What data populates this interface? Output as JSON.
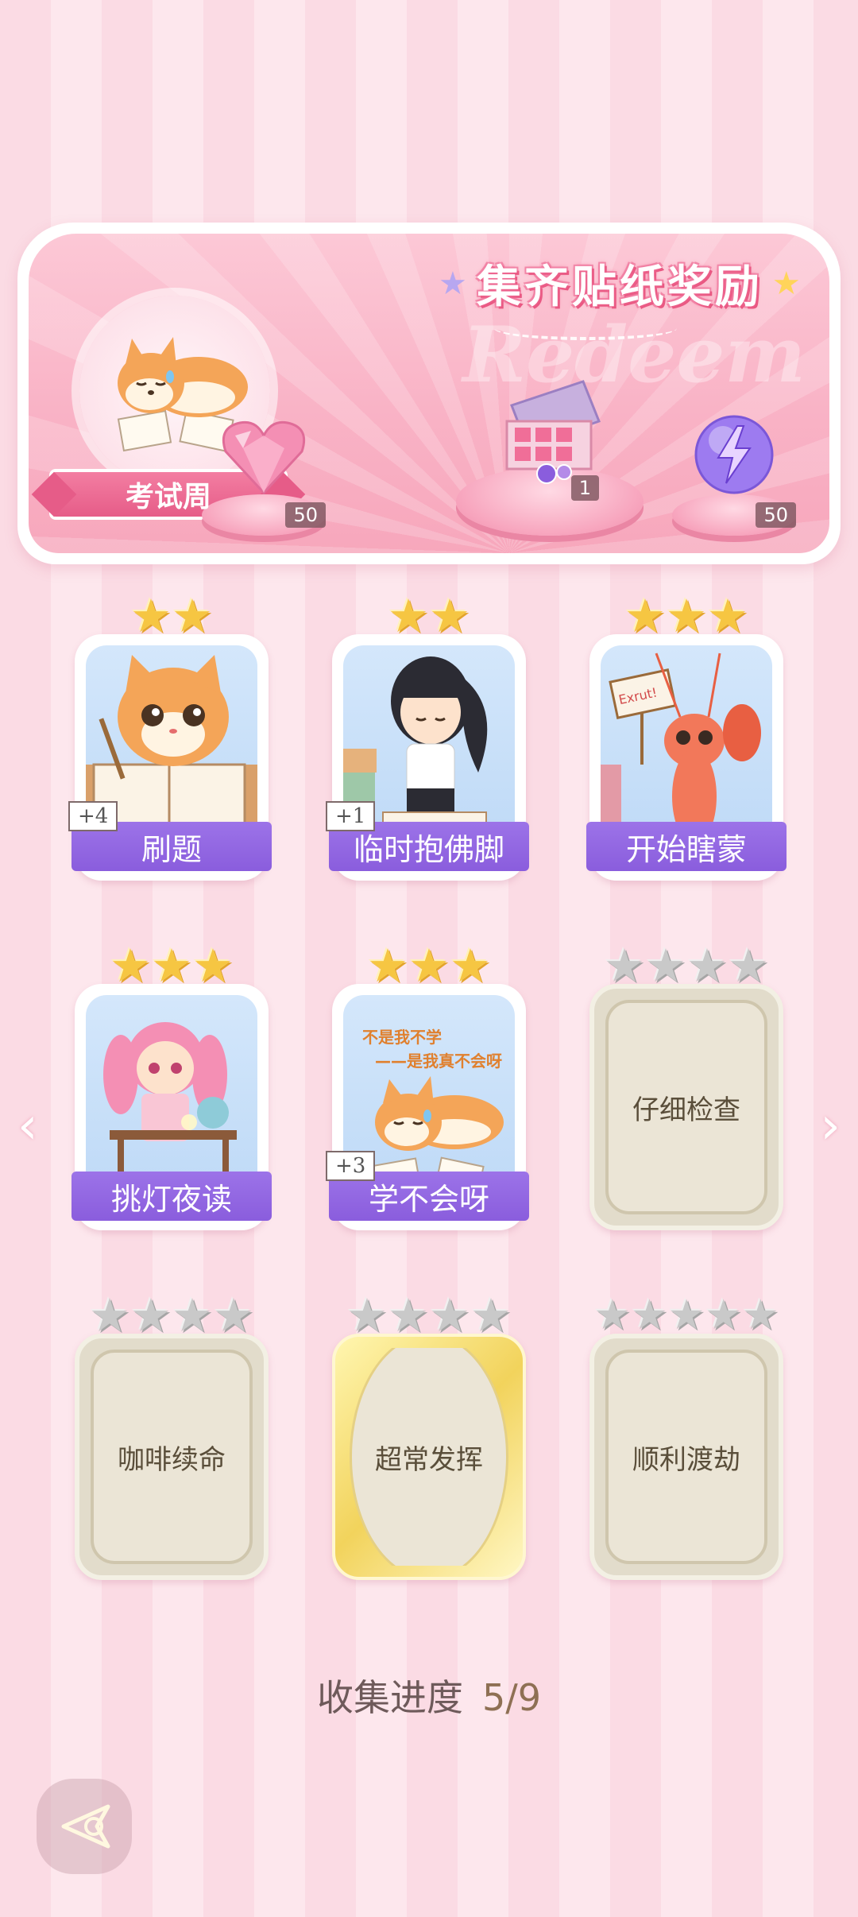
{
  "banner": {
    "title": "集齐贴纸奖励",
    "watermark": "Redeem",
    "theme_label": "考试周",
    "rewards": [
      {
        "icon": "pink-heart-gem-icon",
        "count": "50"
      },
      {
        "icon": "gift-box-icon",
        "count": "1"
      },
      {
        "icon": "lightning-orb-icon",
        "count": "50"
      }
    ]
  },
  "cards": [
    {
      "name": "刷题",
      "stars": 2,
      "max_stars": 2,
      "plus": "+4",
      "state": "collected",
      "art": "cat-studying"
    },
    {
      "name": "临时抱佛脚",
      "stars": 2,
      "max_stars": 2,
      "plus": "+1",
      "state": "collected",
      "art": "girl-reading"
    },
    {
      "name": "开始瞎蒙",
      "stars": 3,
      "max_stars": 3,
      "plus": "",
      "state": "collected",
      "art": "lobster-sign",
      "sign_text": "Exrut!"
    },
    {
      "name": "挑灯夜读",
      "stars": 3,
      "max_stars": 3,
      "plus": "",
      "state": "collected",
      "art": "girl-desk"
    },
    {
      "name": "学不会呀",
      "stars": 3,
      "max_stars": 3,
      "plus": "+3",
      "state": "collected",
      "art": "shiba-sad",
      "art_text_1": "不是我不学",
      "art_text_2": "——是我真不会呀"
    },
    {
      "name": "仔细检查",
      "stars": 0,
      "max_stars": 4,
      "plus": "",
      "state": "locked"
    },
    {
      "name": "咖啡续命",
      "stars": 0,
      "max_stars": 4,
      "plus": "",
      "state": "locked"
    },
    {
      "name": "超常发挥",
      "stars": 0,
      "max_stars": 4,
      "plus": "",
      "state": "locked-gold"
    },
    {
      "name": "顺利渡劫",
      "stars": 0,
      "max_stars": 5,
      "plus": "",
      "state": "locked"
    }
  ],
  "progress": {
    "label": "收集进度",
    "value": "5/9"
  },
  "nav": {
    "prev": "‹",
    "next": "›"
  },
  "colors": {
    "accent_purple": "#8a5ddd",
    "star_gold": "#f6c642",
    "pink": "#e65c88"
  }
}
